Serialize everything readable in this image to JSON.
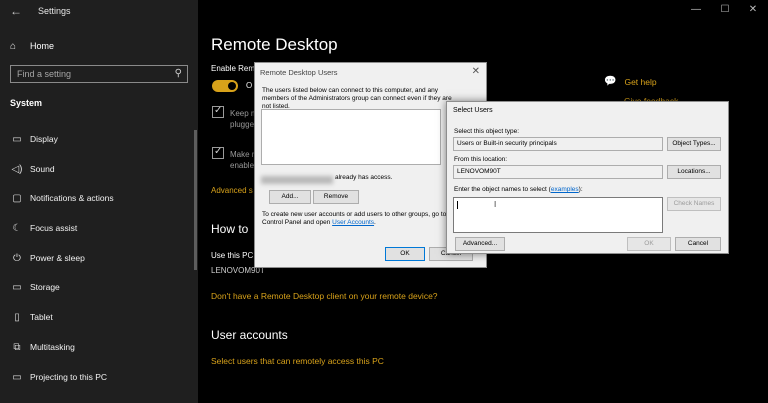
{
  "window": {
    "back_icon": "back-arrow-icon",
    "title": "Settings",
    "controls": [
      "—",
      "☐",
      "✕"
    ]
  },
  "sidebar": {
    "home_label": "Home",
    "search_placeholder": "Find a setting",
    "section": "System",
    "items": [
      {
        "label": "Display",
        "icon": "display-icon",
        "glyph": "▭"
      },
      {
        "label": "Sound",
        "icon": "sound-icon",
        "glyph": "◁)"
      },
      {
        "label": "Notifications & actions",
        "icon": "notifications-icon",
        "glyph": "▢"
      },
      {
        "label": "Focus assist",
        "icon": "focus-assist-icon",
        "glyph": "☾"
      },
      {
        "label": "Power & sleep",
        "icon": "power-icon",
        "glyph": "⏻"
      },
      {
        "label": "Storage",
        "icon": "storage-icon",
        "glyph": "▭"
      },
      {
        "label": "Tablet",
        "icon": "tablet-icon",
        "glyph": "▯"
      },
      {
        "label": "Multitasking",
        "icon": "multitasking-icon",
        "glyph": "⧉"
      },
      {
        "label": "Projecting to this PC",
        "icon": "projecting-icon",
        "glyph": "▭"
      }
    ]
  },
  "main": {
    "title": "Remote Desktop",
    "enable_label": "Enable Rem",
    "toggle_text": "O",
    "checkbox1_text": "Keep m\nplugge",
    "checkbox2_text": "Make m\nenable",
    "advanced_link": "Advanced s",
    "howto_title": "How to",
    "use_pc": "Use this PC",
    "pc_name": "LENOVOM90T",
    "client_link": "Don't have a Remote Desktop client on your remote device?",
    "user_accounts_title": "User accounts",
    "select_users_link": "Select users that can remotely access this PC",
    "get_help": "Get help",
    "give_feedback": "Give feedback"
  },
  "rdu_dialog": {
    "title": "Remote Desktop Users",
    "description": "The users listed below can connect to this computer, and any members of the Administrators group can connect even if they are not listed.",
    "access_text": "already has access.",
    "add_button": "Add...",
    "remove_button": "Remove",
    "info_text": "To create new user accounts or add users to other groups, go to Control Panel and open",
    "info_link": "User Accounts",
    "info_end": ".",
    "ok_button": "OK",
    "cancel_button": "Cancel"
  },
  "select_users_dialog": {
    "title": "Select Users",
    "object_type_label": "Select this object type:",
    "object_type_value": "Users or Built-in security principals",
    "object_types_button": "Object Types...",
    "location_label": "From this location:",
    "location_value": "LENOVOM90T",
    "locations_button": "Locations...",
    "names_label": "Enter the object names to select",
    "names_link": "examples",
    "names_label_end": "):",
    "names_label_open": "(",
    "check_names_button": "Check Names",
    "advanced_button": "Advanced...",
    "ok_button": "OK",
    "cancel_button": "Cancel"
  },
  "colors": {
    "accent": "#d8a21a",
    "link": "#0066cc",
    "sidebar_bg": "#1f1f1f",
    "dialog_bg": "#f0f0f0"
  }
}
